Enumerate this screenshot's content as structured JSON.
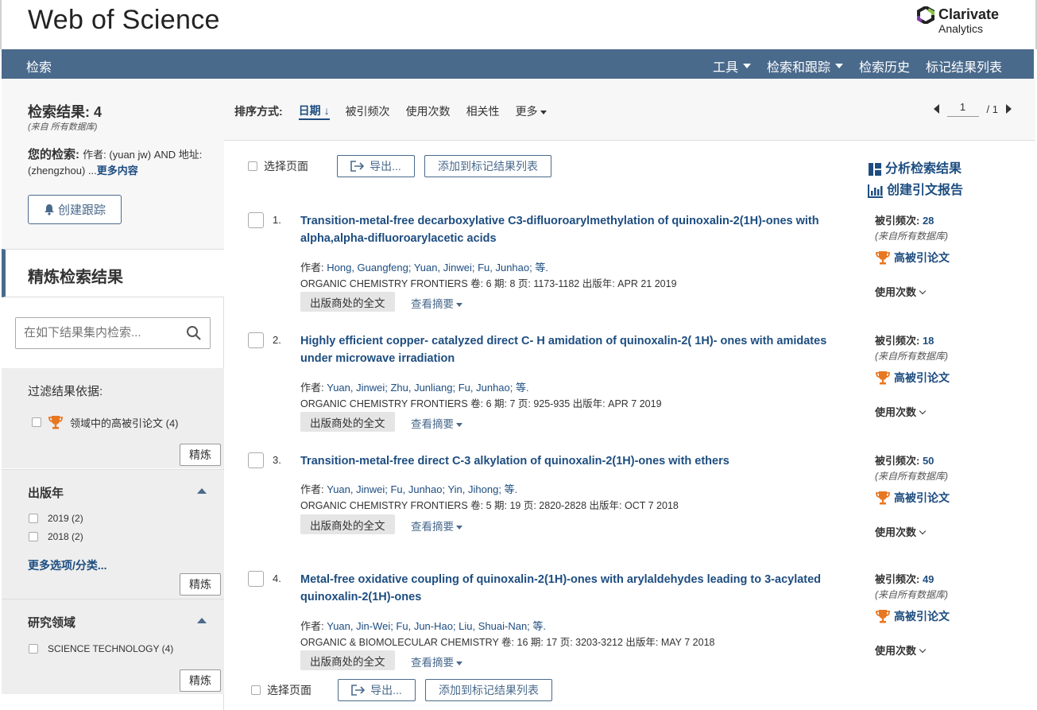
{
  "header": {
    "brand": "Web of Science",
    "clarivate_line1": "Clarivate",
    "clarivate_line2": "Analytics"
  },
  "nav": {
    "home": "检索",
    "tools": "工具",
    "search_track": "检索和跟踪",
    "history": "检索历史",
    "marked": "标记结果列表"
  },
  "sidebar": {
    "result_label": "检索结果: 4",
    "result_sub": "(来自 所有数据库)",
    "your_search_label": "您的检索: ",
    "query_text": "作者: (yuan jw) AND 地址: (zhengzhou) ...",
    "more_content": "更多内容",
    "create_alert": "创建跟踪",
    "refine_heading": "精炼检索结果",
    "search_placeholder": "在如下结果集内检索...",
    "filter_by": "过滤结果依据:",
    "filter_item": "领域中的高被引论文 (4)",
    "refine_btn": "精炼",
    "pubyear_title": "出版年",
    "pubyear_items": [
      "2019 (2)",
      "2018 (2)"
    ],
    "more_options": "更多选项/分类...",
    "research_area_title": "研究领域",
    "research_area_items": [
      "SCIENCE TECHNOLOGY (4)"
    ]
  },
  "sortbar": {
    "label": "排序方式:",
    "date": "日期",
    "times_cited": "被引频次",
    "usage": "使用次数",
    "relevance": "相关性",
    "more": "更多",
    "page_current": "1",
    "page_total": "/ 1"
  },
  "actions": {
    "select_page": "选择页面",
    "export": "导出...",
    "add_marked": "添加到标记结果列表",
    "analyze": "分析检索结果",
    "citation_report": "创建引文报告"
  },
  "record_labels": {
    "authors_prefix": "作者: ",
    "full_text": "出版商处的全文",
    "view_abstract": "查看摘要",
    "times_cited_label": "被引频次: ",
    "from_all": "(来自所有数据库)",
    "highly_cited": "高被引论文",
    "usage_count": "使用次数"
  },
  "records": [
    {
      "num": "1.",
      "title": "Transition-metal-free decarboxylative C3-difluoroarylmethylation of quinoxalin-2(1H)-ones with alpha,alpha-difluoroarylacetic acids",
      "authors": "Hong, Guangfeng; Yuan, Jinwei; Fu, Junhao; 等.",
      "source": "ORGANIC CHEMISTRY FRONTIERS  卷: 6   期: 8   页: 1173-1182   出版年: APR 21 2019",
      "cites": "28"
    },
    {
      "num": "2.",
      "title": "Highly efficient copper- catalyzed direct C- H amidation of quinoxalin-2( 1H)- ones with amidates under microwave irradiation",
      "authors": "Yuan, Jinwei; Zhu, Junliang; Fu, Junhao; 等.",
      "source": "ORGANIC CHEMISTRY FRONTIERS  卷: 6   期: 7   页: 925-935   出版年: APR 7 2019",
      "cites": "18"
    },
    {
      "num": "3.",
      "title": "Transition-metal-free direct C-3 alkylation of quinoxalin-2(1H)-ones with ethers",
      "authors": "Yuan, Jinwei; Fu, Junhao; Yin, Jihong; 等.",
      "source": "ORGANIC CHEMISTRY FRONTIERS  卷: 5   期: 19   页: 2820-2828   出版年: OCT 7 2018",
      "cites": "50"
    },
    {
      "num": "4.",
      "title": "Metal-free oxidative coupling of quinoxalin-2(1H)-ones with arylaldehydes leading to 3-acylated quinoxalin-2(1H)-ones",
      "authors": "Yuan, Jin-Wei; Fu, Jun-Hao; Liu, Shuai-Nan; 等.",
      "source": "ORGANIC & BIOMOLECULAR CHEMISTRY  卷: 16   期: 17   页: 3203-3212   出版年: MAY 7 2018",
      "cites": "49"
    }
  ],
  "colors": {
    "nav_bg": "#4a6a8c",
    "link": "#1d4d80",
    "trophy": "#e87722"
  }
}
